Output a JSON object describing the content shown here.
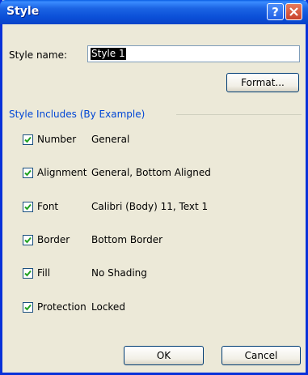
{
  "window": {
    "title": "Style"
  },
  "titlebar": {
    "help_label": "?"
  },
  "style_name": {
    "label": "Style name:",
    "value": "Style 1"
  },
  "buttons": {
    "format": "Format...",
    "ok": "OK",
    "cancel": "Cancel"
  },
  "group": {
    "title": "Style Includes (By Example)"
  },
  "items": [
    {
      "label": "Number",
      "value": "General",
      "checked": true
    },
    {
      "label": "Alignment",
      "value": "General, Bottom Aligned",
      "checked": true
    },
    {
      "label": "Font",
      "value": "Calibri (Body) 11, Text 1",
      "checked": true
    },
    {
      "label": "Border",
      "value": "Bottom Border",
      "checked": true
    },
    {
      "label": "Fill",
      "value": "No Shading",
      "checked": true
    },
    {
      "label": "Protection",
      "value": "Locked",
      "checked": true
    }
  ],
  "colors": {
    "titlebar": "#0b50d8",
    "dialog_bg": "#ece9d8",
    "group_title": "#0046d5",
    "check": "#21a121"
  }
}
